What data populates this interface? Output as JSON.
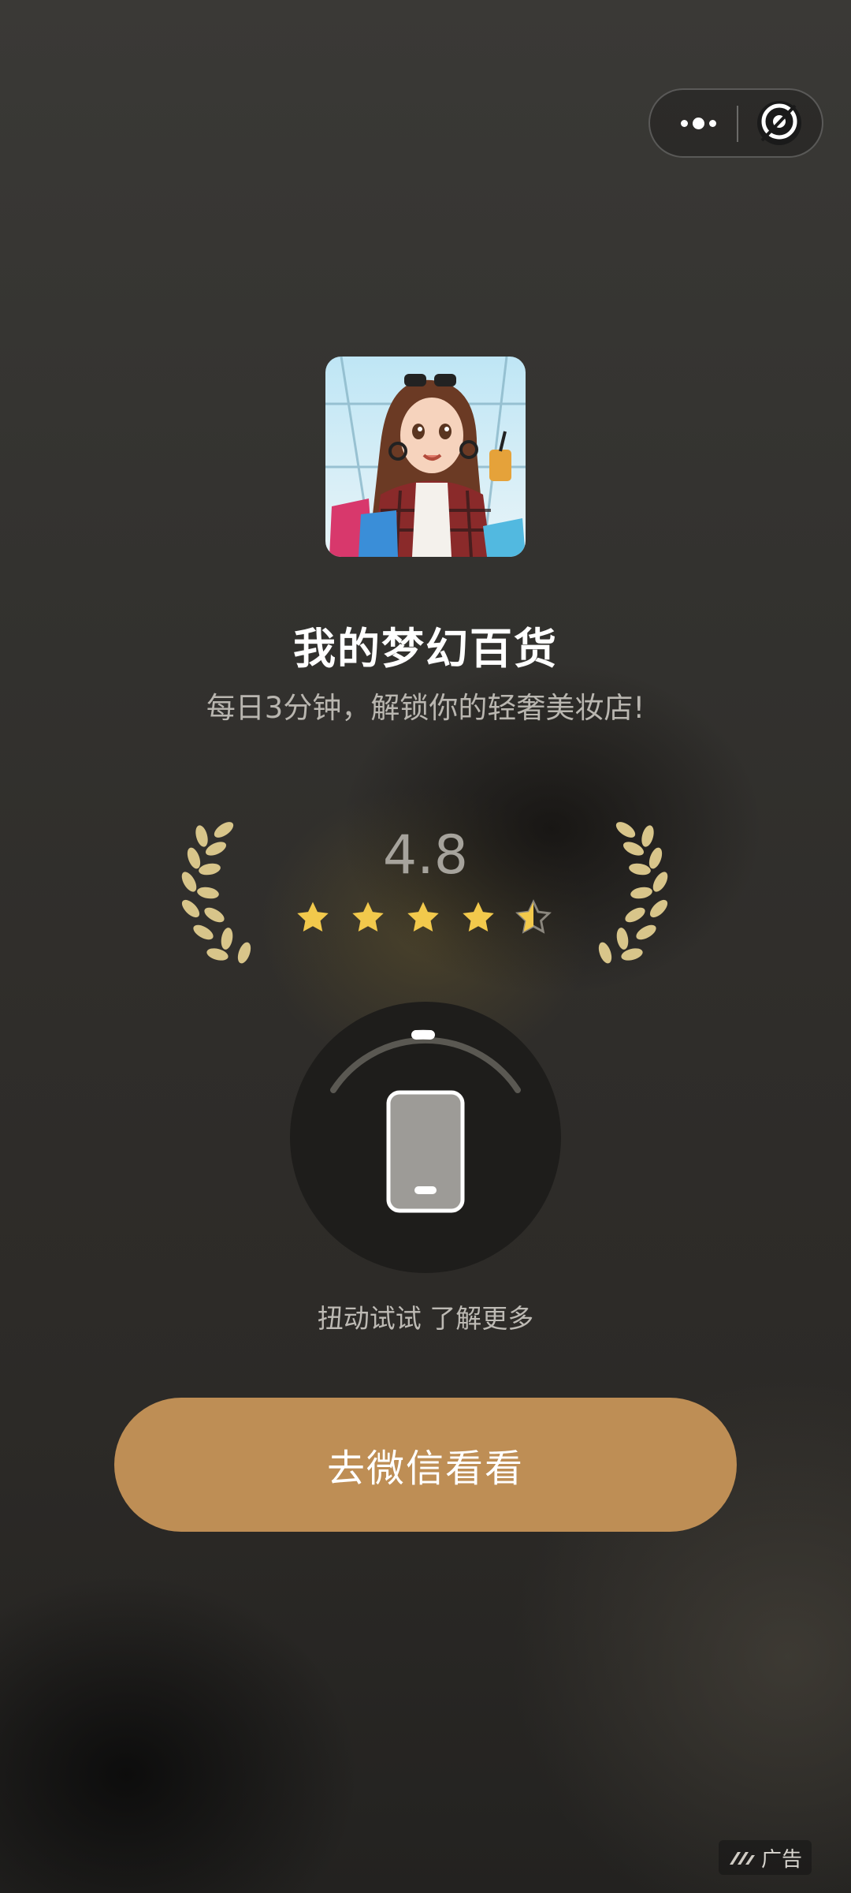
{
  "capsule": {
    "more_icon": "more-dots-icon",
    "close_icon": "close-target-icon"
  },
  "app": {
    "icon": "app-icon-shopping-girl",
    "name": "我的梦幻百货",
    "slogan": "每日3分钟，解锁你的轻奢美妆店!"
  },
  "rating": {
    "value": "4.8",
    "stars": 4.5,
    "laurel_color": "#d8c58a",
    "star_color": "#f2c94c"
  },
  "twist": {
    "icon": "phone-icon",
    "hint": "扭动试试 了解更多"
  },
  "cta": {
    "label": "去微信看看",
    "color": "#be8e55"
  },
  "ad": {
    "icon": "ad-logo-icon",
    "label": "广告"
  }
}
